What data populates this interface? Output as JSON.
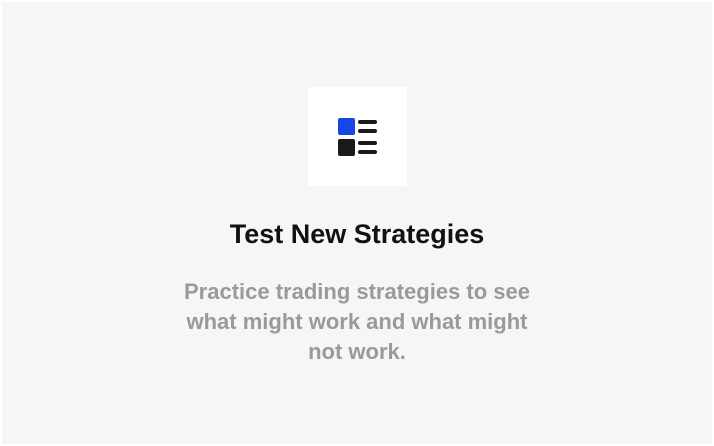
{
  "feature": {
    "icon": "list-layout-icon",
    "title": "Test New Strategies",
    "description": "Practice trading strategies to see what might work and what might not work."
  },
  "colors": {
    "card_background": "#f6f6f6",
    "icon_tile_background": "#ffffff",
    "accent": "#1447e6",
    "icon_dark": "#1a1a1a",
    "title": "#111111",
    "description": "#9a9a9a"
  }
}
